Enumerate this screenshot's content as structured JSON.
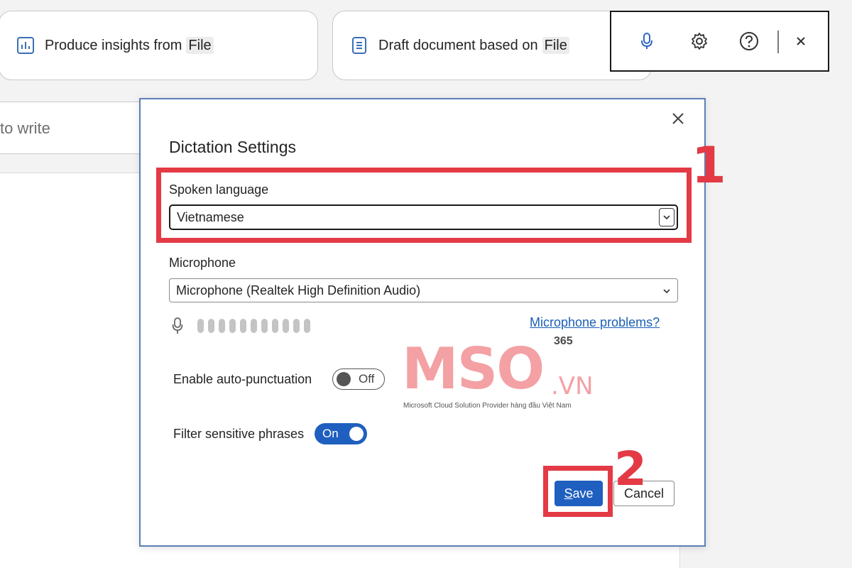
{
  "cards": [
    {
      "text": "Produce insights from",
      "chip": "File",
      "icon": "chart-doc-icon"
    },
    {
      "text": "Draft document based on",
      "chip": "File",
      "icon": "document-icon"
    }
  ],
  "prompt": {
    "placeholder_fragment": "to write"
  },
  "dialog": {
    "title": "Dictation Settings",
    "spoken_language": {
      "label": "Spoken language",
      "value": "Vietnamese"
    },
    "microphone": {
      "label": "Microphone",
      "value": "Microphone (Realtek High Definition Audio)",
      "level_segments": 11
    },
    "mic_problems_link": "Microphone problems?",
    "auto_punctuation": {
      "label": "Enable auto-punctuation",
      "state": "Off"
    },
    "filter_phrases": {
      "label": "Filter sensitive phrases",
      "state": "On"
    },
    "save": {
      "label_u": "S",
      "label_rest": "ave"
    },
    "cancel_label": "Cancel"
  },
  "annotations": {
    "step1": "1",
    "step2": "2"
  },
  "watermark": {
    "logo": "MSO",
    "domain": ".VN",
    "tag": "365",
    "tagline": "Microsoft Cloud Solution Provider hàng đầu Việt Nam"
  },
  "colors": {
    "accent": "#1f5fbf",
    "highlight": "#e33a45",
    "link": "#1a5fb4",
    "watermark": "#f3a1a4"
  }
}
